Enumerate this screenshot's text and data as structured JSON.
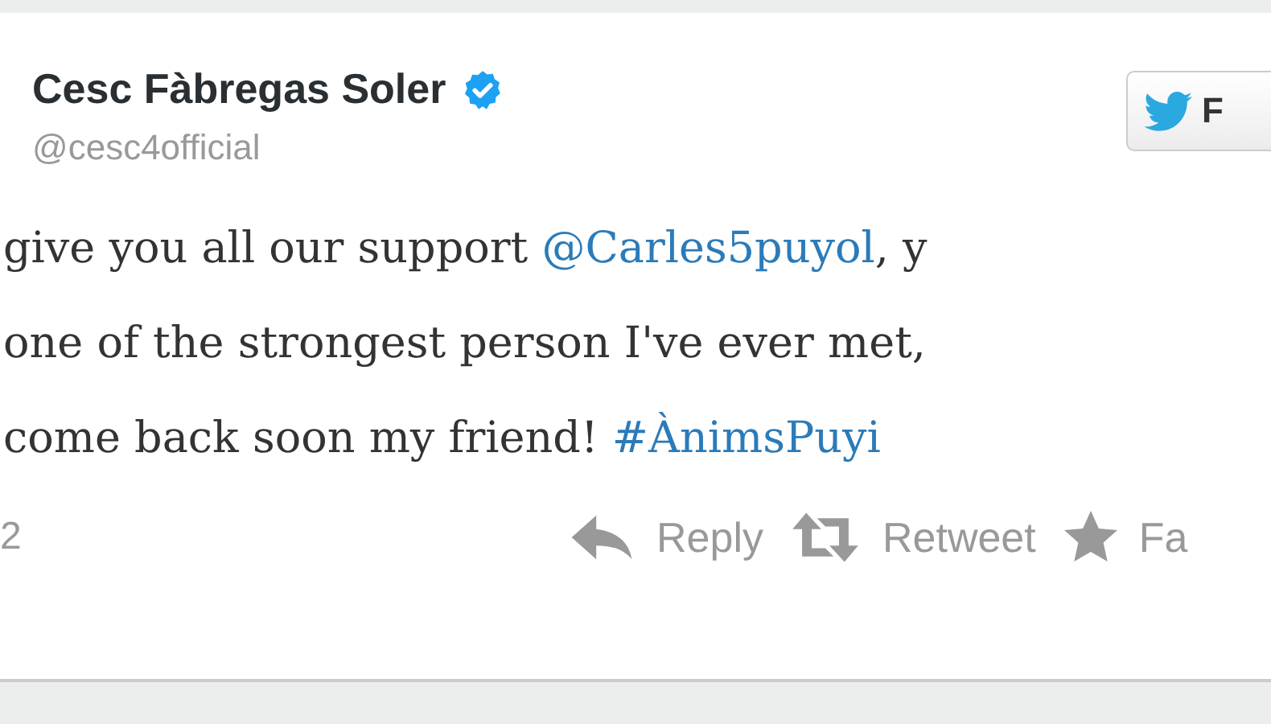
{
  "author": {
    "name": "Cesc Fàbregas Soler",
    "verified": true,
    "handle": "@cesc4official"
  },
  "follow_button": {
    "label": "F"
  },
  "tweet": {
    "lines": [
      [
        {
          "kind": "text",
          "text": "give you all our support "
        },
        {
          "kind": "mention",
          "text": "@Carles5puyol"
        },
        {
          "kind": "text",
          "text": ", y"
        }
      ],
      [
        {
          "kind": "text",
          "text": "one of the strongest person I've ever met,"
        }
      ],
      [
        {
          "kind": "text",
          "text": "come back soon my friend! "
        },
        {
          "kind": "hashtag",
          "text": "#ÀnimsPuyi"
        }
      ]
    ]
  },
  "footer": {
    "date": "2",
    "actions": [
      {
        "kind": "reply",
        "label": "Reply"
      },
      {
        "kind": "retweet",
        "label": "Retweet"
      },
      {
        "kind": "favorite",
        "label": "Fa"
      }
    ]
  }
}
